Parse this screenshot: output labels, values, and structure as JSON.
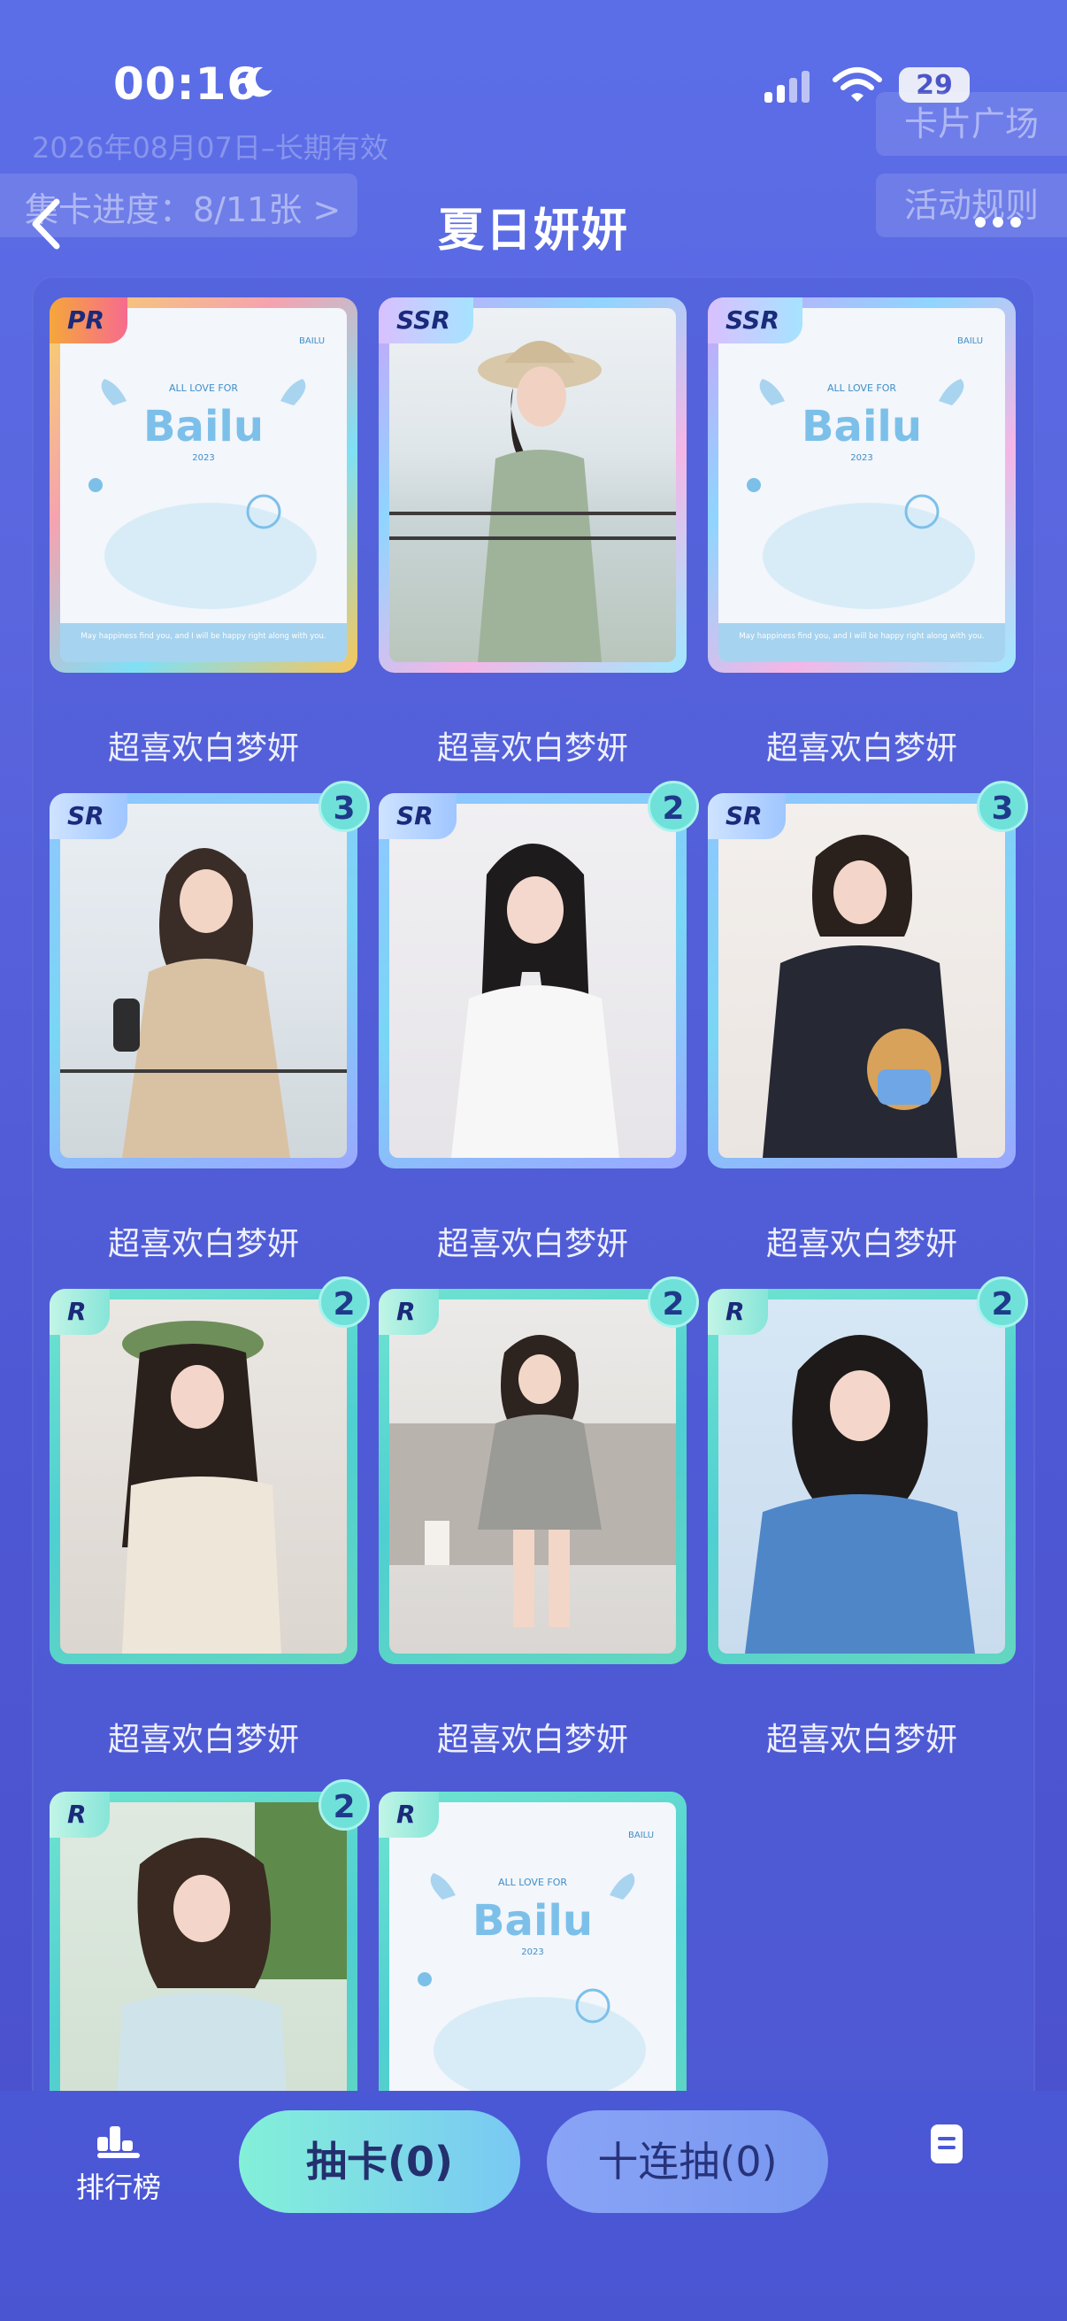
{
  "status_bar": {
    "time": "00:16",
    "battery": "29"
  },
  "validity": "2026年08月07日–长期有效",
  "header": {
    "progress": "集卡进度：8/11张 >",
    "title": "夏日妍妍",
    "card_plaza": "卡片广场",
    "rules": "活动规则"
  },
  "cards": [
    {
      "rarity": "PR",
      "name": "超喜欢白梦妍",
      "count": null
    },
    {
      "rarity": "SSR",
      "name": "超喜欢白梦妍",
      "count": null
    },
    {
      "rarity": "SSR",
      "name": "超喜欢白梦妍",
      "count": null
    },
    {
      "rarity": "SR",
      "name": "超喜欢白梦妍",
      "count": "3"
    },
    {
      "rarity": "SR",
      "name": "超喜欢白梦妍",
      "count": "2"
    },
    {
      "rarity": "SR",
      "name": "超喜欢白梦妍",
      "count": "3"
    },
    {
      "rarity": "R",
      "name": "超喜欢白梦妍",
      "count": "2"
    },
    {
      "rarity": "R",
      "name": "超喜欢白梦妍",
      "count": "2"
    },
    {
      "rarity": "R",
      "name": "超喜欢白梦妍",
      "count": "2"
    },
    {
      "rarity": "R",
      "name": "",
      "count": "2"
    },
    {
      "rarity": "R",
      "name": "",
      "count": null
    }
  ],
  "bailu_card": {
    "small": "ALL LOVE FOR",
    "logo": "Bailu",
    "year": "2023",
    "brand": "BAILU",
    "message": "May happiness find you, and I will be happy right along with you."
  },
  "bottom": {
    "rank_label": "排行榜",
    "draw_label": "抽卡(0)",
    "draw10_label": "十连抽(0)"
  },
  "colors": {
    "background": "#5a66de",
    "accent_teal": "#6fe1d9",
    "button_primary": "#83f0d8",
    "button_secondary": "#7d9bf2"
  }
}
